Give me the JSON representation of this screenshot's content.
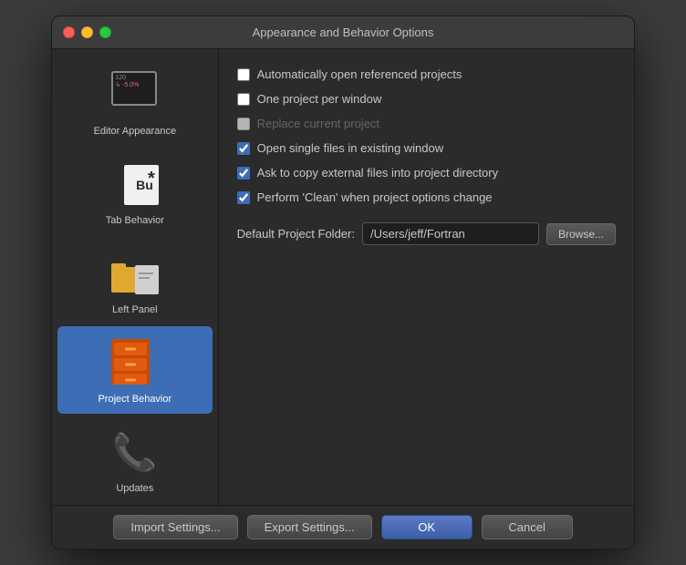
{
  "window": {
    "title": "Appearance and Behavior Options"
  },
  "sidebar": {
    "items": [
      {
        "id": "editor-appearance",
        "label": "Editor Appearance",
        "active": false
      },
      {
        "id": "tab-behavior",
        "label": "Tab Behavior",
        "active": false
      },
      {
        "id": "left-panel",
        "label": "Left Panel",
        "active": false
      },
      {
        "id": "project-behavior",
        "label": "Project Behavior",
        "active": true
      },
      {
        "id": "updates",
        "label": "Updates",
        "active": false
      }
    ]
  },
  "main": {
    "checkboxes": [
      {
        "id": "auto-open",
        "label": "Automatically open referenced projects",
        "checked": false,
        "disabled": false
      },
      {
        "id": "one-project",
        "label": "One project per window",
        "checked": false,
        "disabled": false
      },
      {
        "id": "replace-current",
        "label": "Replace current project",
        "checked": false,
        "disabled": true
      },
      {
        "id": "open-single",
        "label": "Open single files in existing window",
        "checked": true,
        "disabled": false
      },
      {
        "id": "copy-external",
        "label": "Ask to copy external files into project directory",
        "checked": true,
        "disabled": false
      },
      {
        "id": "perform-clean",
        "label": "Perform 'Clean' when project options change",
        "checked": true,
        "disabled": false
      }
    ],
    "folder": {
      "label": "Default Project Folder:",
      "value": "/Users/jeff/Fortran",
      "browse_label": "Browse..."
    }
  },
  "footer": {
    "import_label": "Import Settings...",
    "export_label": "Export Settings...",
    "ok_label": "OK",
    "cancel_label": "Cancel"
  }
}
